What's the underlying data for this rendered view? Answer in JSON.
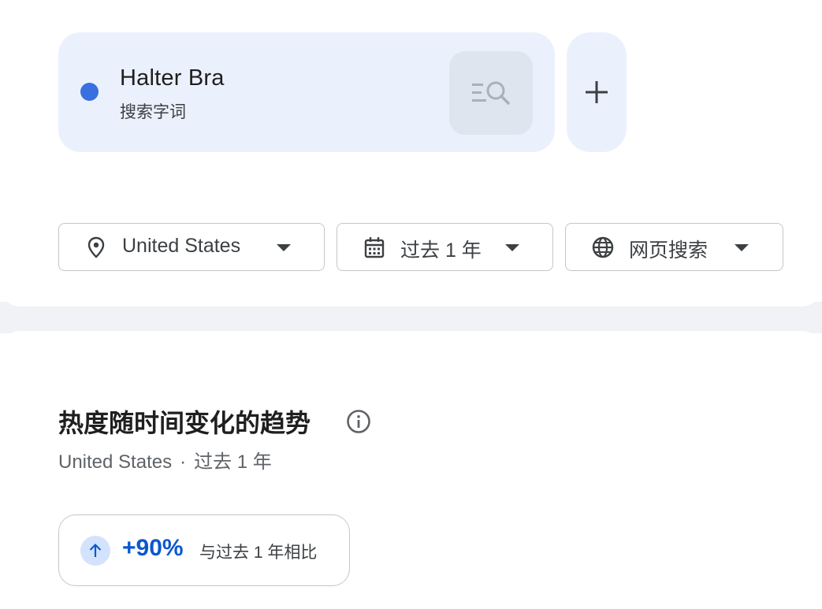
{
  "term": {
    "name": "Halter Bra",
    "type": "搜索字词",
    "dot_color": "#3a6fe0",
    "explore_icon": "explore-list-search-icon"
  },
  "add_term": {
    "icon": "plus-icon"
  },
  "filters": {
    "geo": {
      "label": "United States",
      "icon": "location-pin-icon"
    },
    "time": {
      "label": "过去 1 年",
      "icon": "calendar-icon"
    },
    "property": {
      "label": "网页搜索",
      "icon": "globe-icon"
    }
  },
  "section": {
    "title": "热度随时间变化的趋势",
    "subtitle_geo": "United States",
    "subtitle_sep": "·",
    "subtitle_time": "过去 1 年",
    "info_icon": "info-icon"
  },
  "change": {
    "value": "+90%",
    "description": "与过去 1 年相比",
    "direction_icon": "arrow-up-icon",
    "accent_color": "#0b57d0"
  }
}
